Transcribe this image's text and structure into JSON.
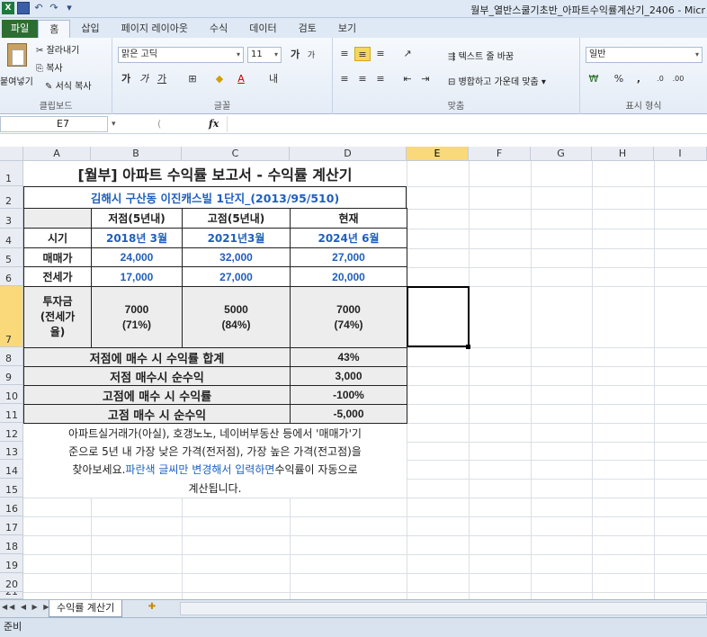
{
  "window": {
    "title": "월부_열반스쿨기초반_아파트수익률계산기_2406 - Micr",
    "qa_icons": [
      "excel-icon",
      "save-icon",
      "undo-icon",
      "redo-icon",
      "customize-icon"
    ]
  },
  "ribbon_tabs": [
    "파일",
    "홈",
    "삽입",
    "페이지 레이아웃",
    "수식",
    "데이터",
    "검토",
    "보기"
  ],
  "ribbon": {
    "clipboard": {
      "paste": "붙여넣기",
      "cut": "잘라내기",
      "copy": "복사",
      "format_painter": "서식 복사",
      "label": "클립보드"
    },
    "font": {
      "font_name": "맑은 고딕",
      "font_size": "11",
      "bold": "가",
      "italic": "가",
      "underline": "가",
      "grow": "가",
      "shrink": "가",
      "label": "글꼴"
    },
    "alignment": {
      "wrap_text": "텍스트 줄 바꿈",
      "merge_center": "병합하고 가운데 맞춤",
      "label": "맞춤"
    },
    "number": {
      "format": "일반",
      "percent": "%",
      "comma": ",",
      "label": "표시 형식"
    }
  },
  "formula_bar": {
    "name_box": "E7",
    "fx": "fx",
    "value": ""
  },
  "columns": [
    "A",
    "B",
    "C",
    "D",
    "E",
    "F",
    "G",
    "H",
    "I"
  ],
  "rows": [
    "1",
    "2",
    "3",
    "4",
    "5",
    "6",
    "7",
    "8",
    "9",
    "10",
    "11",
    "12",
    "13",
    "14",
    "15",
    "16",
    "17",
    "18",
    "19",
    "20",
    "21"
  ],
  "sheet": {
    "title": "[월부] 아파트 수익률 보고서 - 수익률 계산기",
    "subtitle": "김해시 구산동 이진캐스빌 1단지_(2013/95/510)",
    "headers": [
      "저점(5년내)",
      "고점(5년내)",
      "현재"
    ],
    "rows": [
      {
        "label": "시기",
        "values": [
          "2018년 3월",
          "2021년3월",
          "2024년 6월"
        ]
      },
      {
        "label": "매매가",
        "values": [
          "24,000",
          "32,000",
          "27,000"
        ]
      },
      {
        "label": "전세가",
        "values": [
          "17,000",
          "27,000",
          "20,000"
        ]
      },
      {
        "label": "투자금 (전세가율)",
        "values": [
          "7000 (71%)",
          "5000 (84%)",
          "7000 (74%)"
        ]
      }
    ],
    "summary": [
      {
        "label": "저점에 매수 시 수익률 합계",
        "value": "43%"
      },
      {
        "label": "저점 매수시 순수익",
        "value": "3,000"
      },
      {
        "label": "고점에 매수 시 수익률",
        "value": "-100%"
      },
      {
        "label": "고점 매수 시 순수익",
        "value": "-5,000"
      }
    ],
    "note": {
      "line1": "아파트실거래가(아실), 호갱노노, 네이버부동산 등에서 '매매가'기",
      "line2": "준으로 5년 내 가장 낮은 가격(전저점), 가장 높은 가격(전고점)을",
      "line3_a": "찾아보세요. ",
      "line3_b": "파란색 글씨만 변경해서 입력하면",
      "line3_c": " 수익률이 자동으로",
      "line4": "계산됩니다."
    }
  },
  "sheet_tabs": [
    "수익률 계산기"
  ],
  "status": "준비",
  "colors": {
    "blue_input": "#1f5fbf",
    "selected_header": "#f9d97a",
    "file_tab": "#2c6e32"
  }
}
